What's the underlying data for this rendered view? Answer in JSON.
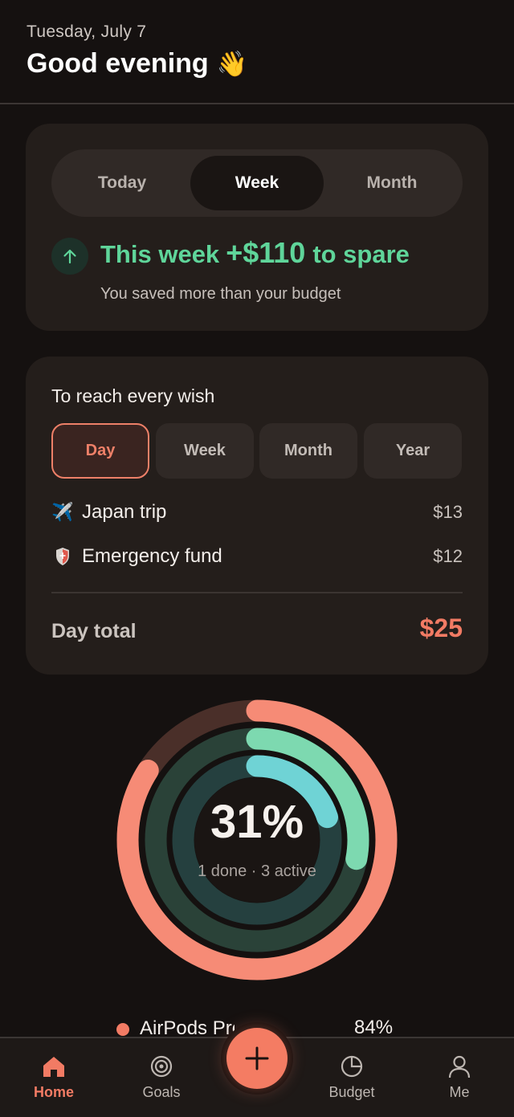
{
  "header": {
    "date": "Tuesday, July 7",
    "greeting": "Good evening",
    "greeting_emoji": "👋"
  },
  "spare_card": {
    "segments": [
      "Today",
      "Week",
      "Month"
    ],
    "selected_segment": "Week",
    "title_prefix": "This week",
    "amount": "+$110",
    "title_suffix": "to spare",
    "subtitle": "You saved more than your budget",
    "accent_color": "#5fd59a"
  },
  "wish_card": {
    "title": "To reach every wish",
    "periods": [
      "Day",
      "Week",
      "Month",
      "Year"
    ],
    "selected_period": "Day",
    "goals": [
      {
        "icon": "airplane-icon",
        "emoji": "✈️",
        "name": "Japan trip",
        "amount": "$13"
      },
      {
        "icon": "shield-icon",
        "emoji": "",
        "name": "Emergency fund",
        "amount": "$12"
      }
    ],
    "total_label": "Day total",
    "total_value": "$25",
    "accent_color": "#f27b64"
  },
  "progress": {
    "percent": "31%",
    "summary": "1 done · 3 active",
    "rings": [
      {
        "color": "#f68b76",
        "track": "#4a2f29",
        "fraction": 0.84
      },
      {
        "color": "#7dd9b0",
        "track": "#2a4238",
        "fraction": 0.28
      },
      {
        "color": "#6fd3d5",
        "track": "#25403f",
        "fraction": 0.2
      }
    ]
  },
  "goal_preview": {
    "name": "AirPods Pro",
    "percent": "84%",
    "color": "#f27b64"
  },
  "tabbar": {
    "tabs": [
      {
        "label": "Home",
        "icon": "home-icon",
        "active": true
      },
      {
        "label": "Goals",
        "icon": "target-icon",
        "active": false
      },
      {
        "label": "Budget",
        "icon": "pie-chart-icon",
        "active": false
      },
      {
        "label": "Me",
        "icon": "person-icon",
        "active": false
      }
    ],
    "fab_icon": "plus-icon",
    "active_color": "#f27b64"
  }
}
